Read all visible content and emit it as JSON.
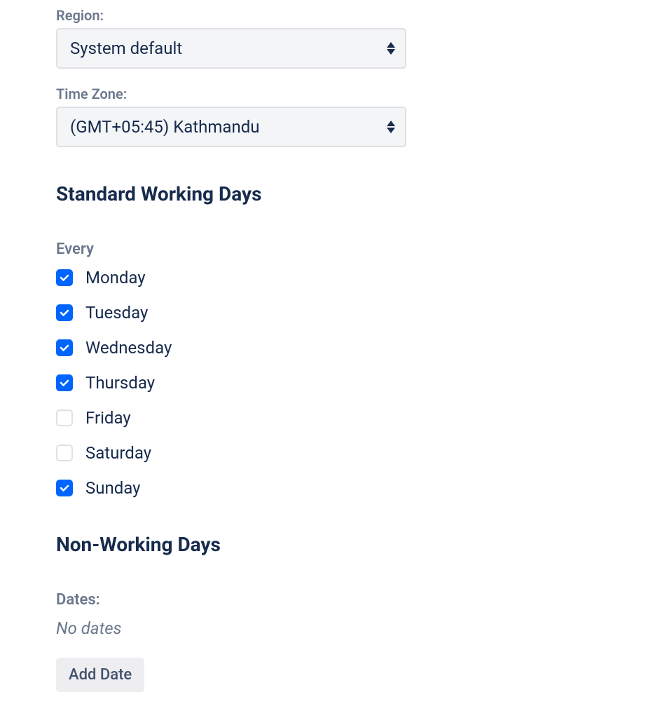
{
  "region": {
    "label": "Region:",
    "value": "System default"
  },
  "timezone": {
    "label": "Time Zone:",
    "value": "(GMT+05:45) Kathmandu"
  },
  "working_days": {
    "heading": "Standard Working Days",
    "every_label": "Every",
    "days": [
      {
        "label": "Monday",
        "checked": true
      },
      {
        "label": "Tuesday",
        "checked": true
      },
      {
        "label": "Wednesday",
        "checked": true
      },
      {
        "label": "Thursday",
        "checked": true
      },
      {
        "label": "Friday",
        "checked": false
      },
      {
        "label": "Saturday",
        "checked": false
      },
      {
        "label": "Sunday",
        "checked": true
      }
    ]
  },
  "non_working": {
    "heading": "Non-Working Days",
    "dates_label": "Dates:",
    "empty_text": "No dates",
    "add_button": "Add Date"
  }
}
